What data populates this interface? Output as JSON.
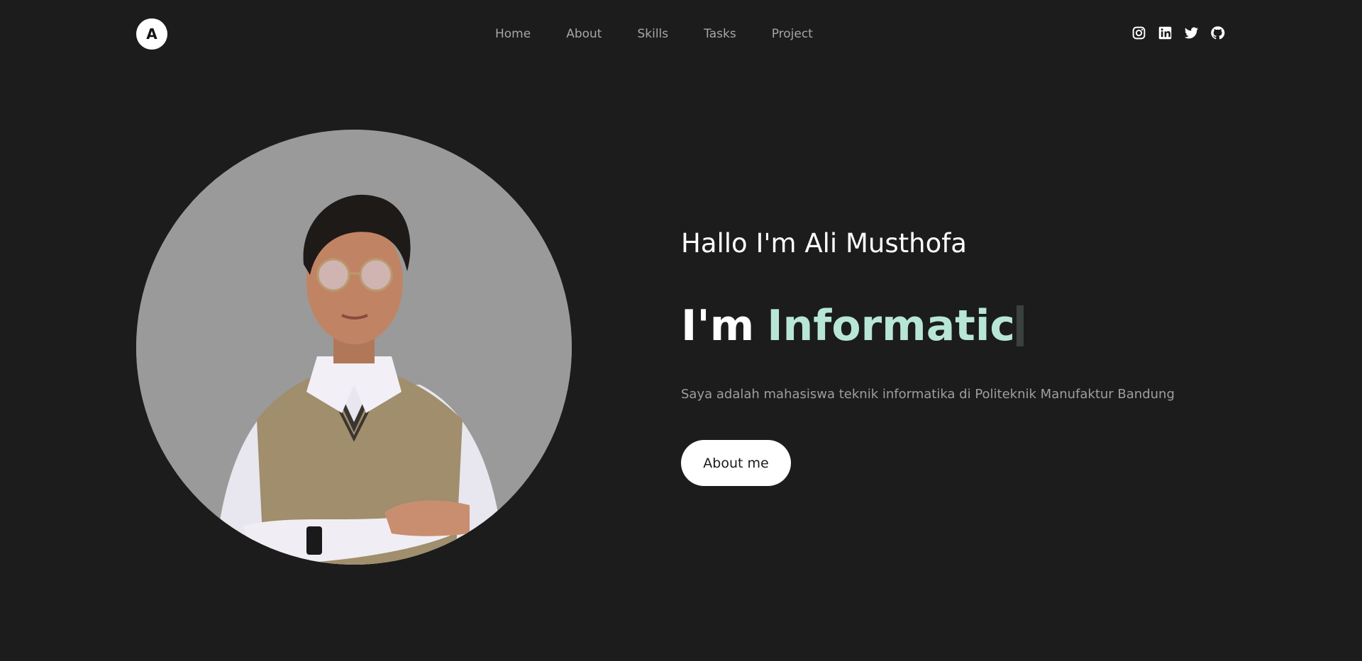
{
  "header": {
    "logo_text": "A",
    "nav": [
      "Home",
      "About",
      "Skills",
      "Tasks",
      "Project"
    ],
    "socials": [
      "instagram-icon",
      "linkedin-icon",
      "twitter-icon",
      "github-icon"
    ]
  },
  "hero": {
    "greeting": "Hallo I'm Ali Musthofa",
    "headline_prefix": "I'm",
    "headline_typed": "Informatic",
    "description": "Saya adalah mahasiswa teknik informatika di Politeknik Manufaktur Bandung",
    "cta_label": "About me"
  },
  "colors": {
    "background": "#1c1c1c",
    "accent": "#b8e6d6",
    "photo_bg": "#9a9a9a"
  }
}
